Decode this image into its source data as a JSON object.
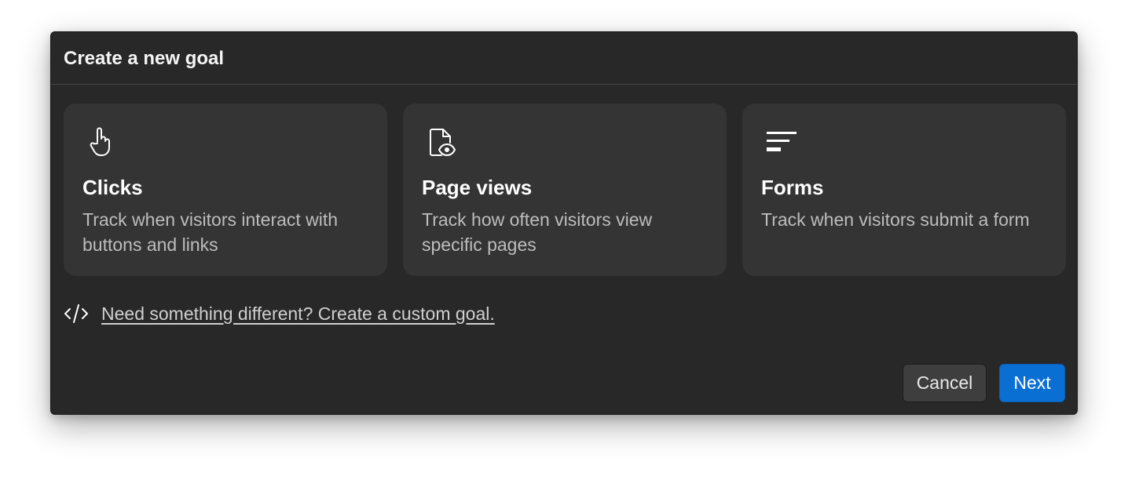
{
  "dialog": {
    "title": "Create a new goal"
  },
  "cards": [
    {
      "icon": "pointer-hand-icon",
      "title": "Clicks",
      "description": "Track when visitors interact with buttons and links"
    },
    {
      "icon": "page-eye-icon",
      "title": "Page views",
      "description": "Track how often visitors view specific pages"
    },
    {
      "icon": "form-lines-icon",
      "title": "Forms",
      "description": "Track when visitors submit a form"
    }
  ],
  "custom": {
    "icon": "code-icon",
    "link_text": "Need something different? Create a custom goal."
  },
  "footer": {
    "cancel_label": "Cancel",
    "next_label": "Next"
  },
  "colors": {
    "dialog_bg": "#282828",
    "card_bg": "#343434",
    "primary": "#0a6fd3"
  }
}
